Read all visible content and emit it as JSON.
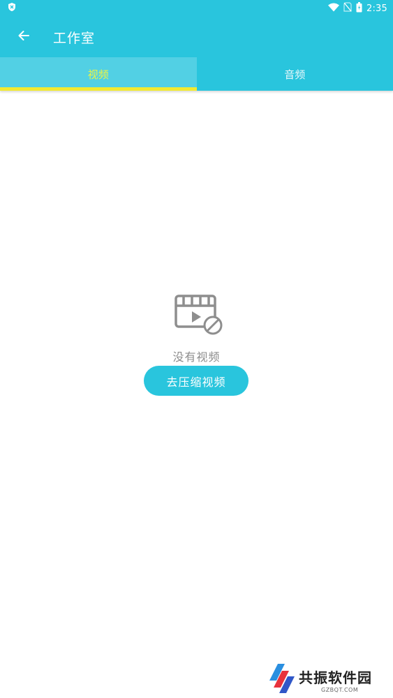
{
  "status_bar": {
    "time": "2:35",
    "icons": [
      "shield-icon",
      "wifi-icon",
      "no-sim-icon",
      "battery-icon"
    ]
  },
  "app_bar": {
    "title": "工作室",
    "back_icon": "arrow-left-icon"
  },
  "tabs": [
    {
      "label": "视频",
      "active": true
    },
    {
      "label": "音频",
      "active": false
    }
  ],
  "empty_state": {
    "icon": "video-off-icon",
    "message": "没有视频"
  },
  "action": {
    "compress_label": "去压缩视频"
  },
  "watermark": {
    "name": "共振软件园",
    "site": "GZBQT.COM"
  },
  "colors": {
    "primary": "#29c5dd",
    "tab_active_bg": "#52d0e4",
    "tab_active_text": "#eef542",
    "indicator": "#f2ea30",
    "empty_text": "#8c8c8c"
  }
}
